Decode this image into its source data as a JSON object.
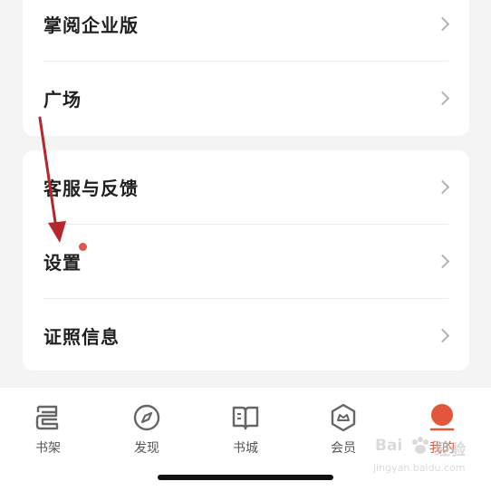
{
  "menu": {
    "group1": [
      {
        "label": "掌阅企业版"
      },
      {
        "label": "广场"
      }
    ],
    "group2": [
      {
        "label": "客服与反馈"
      },
      {
        "label": "设置"
      },
      {
        "label": "证照信息"
      }
    ]
  },
  "tabbar": {
    "tabs": [
      {
        "label": "书架",
        "icon": "bookshelf-icon"
      },
      {
        "label": "发现",
        "icon": "compass-icon"
      },
      {
        "label": "书城",
        "icon": "book-icon"
      },
      {
        "label": "会员",
        "icon": "member-icon"
      },
      {
        "label": "我的",
        "icon": "profile-icon",
        "active": true
      }
    ]
  },
  "watermark": {
    "brand_text": "Bai",
    "site_text": "经验",
    "url": "jingyan.baidu.com"
  },
  "colors": {
    "accent": "#e4553e",
    "notification_dot": "#e0584c",
    "annotation_arrow": "#b5272d"
  }
}
